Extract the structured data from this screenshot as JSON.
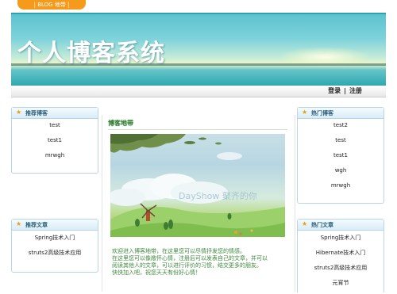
{
  "top_tab": {
    "label": "| BLOG 地带 |"
  },
  "banner": {
    "title": "个人博客系统"
  },
  "nav": {
    "login": "登录",
    "separator": "|",
    "register": "注册"
  },
  "recommended_blogs": {
    "title": "推荐博客",
    "items": [
      "test",
      "test1",
      "mrwgh"
    ]
  },
  "hot_blogs": {
    "title": "热门博客",
    "items": [
      "test2",
      "test",
      "test1",
      "wgh",
      "mrwgh"
    ]
  },
  "recommended_articles": {
    "title": "推荐文章",
    "items": [
      "Spring技术入门",
      "struts2高级技术应用"
    ]
  },
  "hot_articles": {
    "title": "热门文章",
    "items": [
      "Spring技术入门",
      "Hibernate技术入门",
      "struts2高级技术应用",
      "元宵节"
    ]
  },
  "center": {
    "title": "博客地带",
    "watermark": "DayShow 聚齐的你",
    "welcome": [
      "欢迎进入博客地带，在这里您可以尽情抒发您的情感。",
      "在这里您可以像敞怀心情，注册后可以发表自己的文章，并可以",
      "阅读其他人的文章，可以进行评价的习惯，结交更多的朋友。",
      "快快加入吧，祝您天天有份好心情！"
    ]
  },
  "colors": {
    "accent_orange": "#f59a1a",
    "banner_teal": "#2aa3b5",
    "panel_border": "#b9d4e2",
    "welcome_green": "#3d8a3d"
  }
}
